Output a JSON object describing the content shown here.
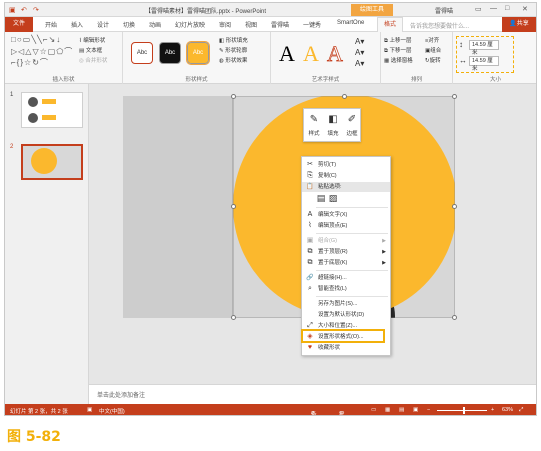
{
  "window": {
    "title": "【雷得喵素材】雷得喵团队.pptx - PowerPoint",
    "context_tab": "绘图工具",
    "user": "雷得喵"
  },
  "tabs": [
    "文件",
    "开始",
    "插入",
    "设计",
    "切换",
    "动画",
    "幻灯片放映",
    "审阅",
    "视图",
    "雷得喵",
    "一键秀",
    "SmartOne",
    "格式"
  ],
  "tellme": "告诉我您想要做什么...",
  "share_label": "共享",
  "ribbon": {
    "insert_shapes": {
      "label": "插入形状",
      "edit_shape": "编辑形状",
      "text_box": "文本框",
      "merge_shapes": "合并形状"
    },
    "shape_styles": {
      "label": "形状样式",
      "style_labels": [
        "Abc",
        "Abc",
        "Abc"
      ],
      "fill": "形状填充",
      "outline": "形状轮廓",
      "effects": "形状效果"
    },
    "wordart": {
      "label": "艺术字样式",
      "glyph": "A"
    },
    "arrange": {
      "label": "排列",
      "bring_forward": "上移一层",
      "send_backward": "下移一层",
      "selection_pane": "选择窗格",
      "align": "对齐",
      "group": "组合",
      "rotate": "旋转"
    },
    "size": {
      "label": "大小",
      "height": "14.59 厘米",
      "width": "14.59 厘米"
    }
  },
  "thumbnails": [
    {
      "num": "1"
    },
    {
      "num": "2"
    }
  ],
  "mini_toolbar": {
    "style": "样式",
    "fill": "填充",
    "outline": "边框"
  },
  "context_menu": [
    {
      "icon": "cut-icon",
      "glyph": "✂",
      "label": "剪切(T)",
      "state": "normal"
    },
    {
      "icon": "copy-icon",
      "glyph": "⎘",
      "label": "复制(C)",
      "state": "normal"
    },
    {
      "icon": "paste-icon",
      "glyph": "📋",
      "label": "粘贴选项:",
      "state": "highlighted"
    },
    {
      "icon": "paste-options-icon",
      "glyph": "▤",
      "label": "",
      "state": "normal"
    },
    {
      "icon": "edit-text-icon",
      "glyph": "A",
      "label": "编辑文字(X)",
      "state": "normal"
    },
    {
      "icon": "edit-points-icon",
      "glyph": "⌇",
      "label": "编辑顶点(E)",
      "state": "normal"
    },
    {
      "icon": "group-icon",
      "glyph": "▣",
      "label": "组合(G)",
      "state": "disabled",
      "submenu": true
    },
    {
      "icon": "bring-front-icon",
      "glyph": "⧉",
      "label": "置于顶层(R)",
      "state": "normal",
      "submenu": true
    },
    {
      "icon": "send-back-icon",
      "glyph": "⧉",
      "label": "置于底层(K)",
      "state": "normal",
      "submenu": true
    },
    {
      "icon": "hyperlink-icon",
      "glyph": "🔗",
      "label": "超链接(H)...",
      "state": "normal"
    },
    {
      "icon": "smart-lookup-icon",
      "glyph": "⌕",
      "label": "智能查找(L)",
      "state": "normal"
    },
    {
      "icon": "save-picture-icon",
      "glyph": "",
      "label": "另存为图片(S)...",
      "state": "normal"
    },
    {
      "icon": "default-shape-icon",
      "glyph": "",
      "label": "设置为默认形状(D)",
      "state": "normal"
    },
    {
      "icon": "size-position-icon",
      "glyph": "⤢",
      "label": "大小和位置(Z)...",
      "state": "normal"
    },
    {
      "icon": "format-shape-icon",
      "glyph": "◈",
      "label": "设置形状格式(O)...",
      "state": "normal"
    },
    {
      "icon": "favorite-shape-icon",
      "glyph": "♥",
      "label": "收藏形状",
      "state": "normal"
    }
  ],
  "notes_placeholder": "单击此处添加备注",
  "status": {
    "slide_info": "幻灯片 第 2 张，共 2 张",
    "language": "中文(中国)",
    "notes": "备注",
    "comments": "批注",
    "zoom": "63%"
  },
  "colors": {
    "accent": "#c43e1c",
    "shape_fill": "#fbb82d",
    "highlight": "#f2b00a"
  },
  "caption": "图 5-82"
}
